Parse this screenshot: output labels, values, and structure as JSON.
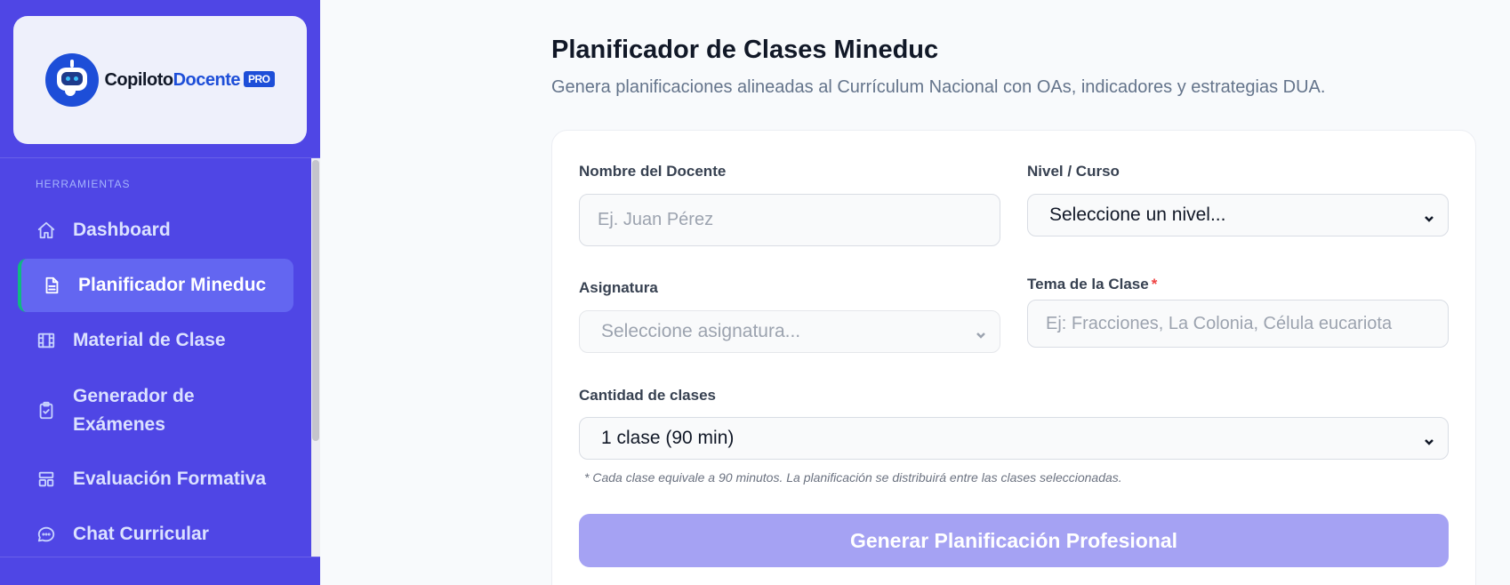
{
  "brand": {
    "name_part1": "Copiloto",
    "name_part2": "Docente",
    "badge": "PRO"
  },
  "sidebar": {
    "section_label": "HERRAMIENTAS",
    "items": [
      {
        "label": "Dashboard",
        "icon": "home-icon"
      },
      {
        "label": "Planificador Mineduc",
        "icon": "document-icon",
        "active": true
      },
      {
        "label": "Material de Clase",
        "icon": "film-icon"
      },
      {
        "label": "Generador de Exámenes",
        "icon": "clipboard-check-icon"
      },
      {
        "label": "Evaluación Formativa",
        "icon": "layout-icon"
      },
      {
        "label": "Chat Curricular",
        "icon": "chat-icon"
      }
    ]
  },
  "page": {
    "title": "Planificador de Clases Mineduc",
    "subtitle": "Genera planificaciones alineadas al Currículum Nacional con OAs, indicadores y estrategias DUA."
  },
  "form": {
    "teacher_label": "Nombre del Docente",
    "teacher_placeholder": "Ej. Juan Pérez",
    "level_label": "Nivel / Curso",
    "level_value": "Seleccione un nivel...",
    "subject_label": "Asignatura",
    "subject_value": "Seleccione asignatura...",
    "topic_label": "Tema de la Clase",
    "topic_required_mark": "*",
    "topic_placeholder": "Ej: Fracciones, La Colonia, Célula eucariota",
    "count_label": "Cantidad de clases",
    "count_value": "1 clase (90 min)",
    "note": "* Cada clase equivale a 90 minutos. La planificación se distribuirá entre las clases seleccionadas.",
    "submit_label": "Generar Planificación Profesional"
  },
  "colors": {
    "sidebar_bg": "#4f46e5",
    "active_item_bg": "#6366f1",
    "active_indicator": "#10b981",
    "button_disabled": "#a5a2f3",
    "brand_blue": "#1d4ed8"
  }
}
